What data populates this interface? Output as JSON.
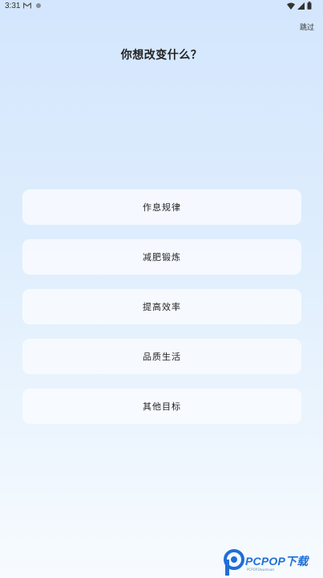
{
  "status_bar": {
    "time": "3:31",
    "icons": [
      "gmail-icon",
      "notification-dot-icon",
      "wifi-icon",
      "signal-icon",
      "battery-icon"
    ]
  },
  "header": {
    "skip_label": "跳过",
    "title": "你想改变什么？"
  },
  "options": [
    {
      "label": "作息规律"
    },
    {
      "label": "减肥锻炼"
    },
    {
      "label": "提高效率"
    },
    {
      "label": "品质生活"
    },
    {
      "label": "其他目标"
    }
  ],
  "watermark": {
    "brand": "PCPOP下载",
    "sub": "PCPOP.Download"
  },
  "colors": {
    "background_top": "#d3e6fd",
    "background_bottom": "#f7fbff",
    "card": "#f8fbff",
    "watermark_blue": "#1e6fd8"
  }
}
